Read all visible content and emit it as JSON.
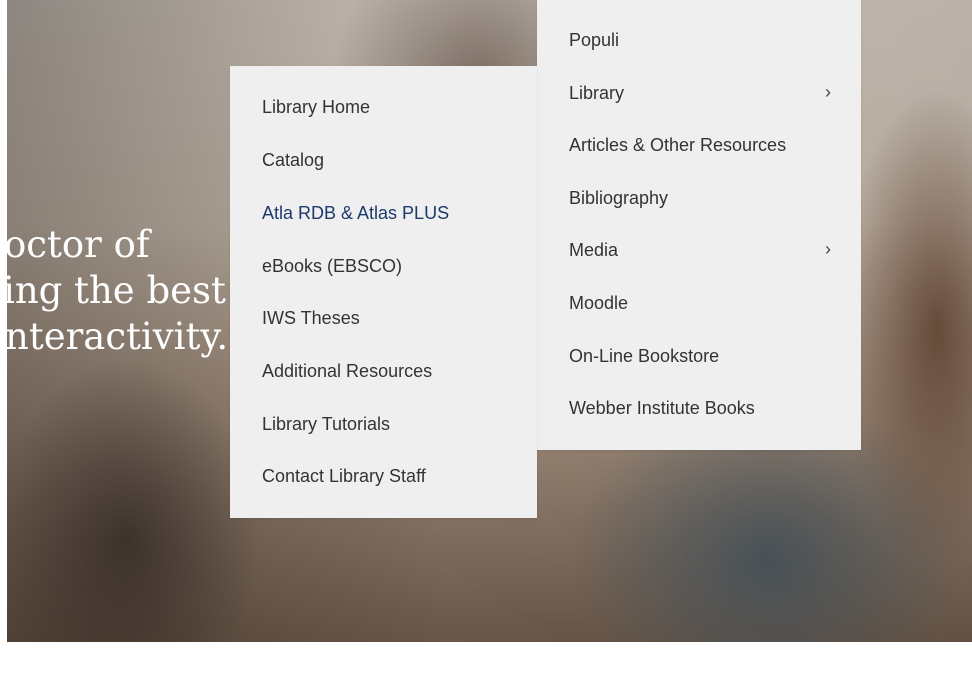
{
  "hero": {
    "lines": [
      "octor of",
      "ing the best",
      "nteractivity."
    ]
  },
  "primary_menu": {
    "items": [
      {
        "label": "Populi",
        "has_submenu": false
      },
      {
        "label": "Library",
        "has_submenu": true,
        "chevron": "›"
      },
      {
        "label": "Articles & Other Resources",
        "has_submenu": false
      },
      {
        "label": "Bibliography",
        "has_submenu": false
      },
      {
        "label": "Media",
        "has_submenu": true,
        "chevron": "›"
      },
      {
        "label": "Moodle",
        "has_submenu": false
      },
      {
        "label": "On-Line Bookstore",
        "has_submenu": false
      },
      {
        "label": "Webber Institute Books",
        "has_submenu": false
      }
    ]
  },
  "library_submenu": {
    "items": [
      {
        "label": "Library Home"
      },
      {
        "label": "Catalog"
      },
      {
        "label": "Atla RDB & Atlas PLUS",
        "active": true
      },
      {
        "label": "eBooks (EBSCO)"
      },
      {
        "label": "IWS Theses"
      },
      {
        "label": "Additional Resources"
      },
      {
        "label": "Library Tutorials"
      },
      {
        "label": "Contact Library Staff"
      }
    ]
  },
  "colors": {
    "menu_bg": "#efefef",
    "menu_text": "#333333",
    "active_link": "#1c3a6b"
  }
}
